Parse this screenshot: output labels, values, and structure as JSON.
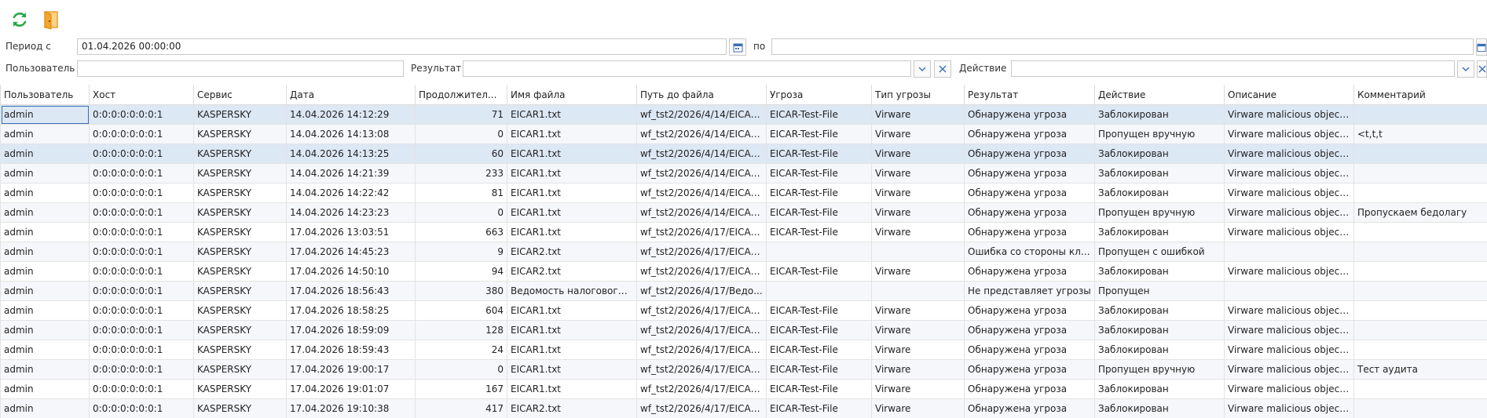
{
  "filters": {
    "period_from_label": "Период с",
    "period_from_value": "01.04.2026 00:00:00",
    "period_to_label": "по",
    "period_to_value": "",
    "user_label": "Пользователь",
    "user_value": "",
    "result_label": "Результат",
    "result_value": "",
    "action_label": "Действие",
    "action_value": ""
  },
  "icons": {
    "refresh": "refresh-icon",
    "exit": "exit-door-icon",
    "calendar": "calendar-icon",
    "chevron": "chevron-down-icon",
    "clear": "close-icon"
  },
  "colors": {
    "refresh": "#2aa84a",
    "exit": "#f2a62b",
    "selected_row": "#dde8f5",
    "accent": "#3b6fb6"
  },
  "table": {
    "columns": [
      "Пользователь",
      "Хост",
      "Сервис",
      "Дата",
      "Продолжител...",
      "Имя файла",
      "Путь до файла",
      "Угроза",
      "Тип угрозы",
      "Результат",
      "Действие",
      "Описание",
      "Комментарий"
    ],
    "rows": [
      [
        "admin",
        "0:0:0:0:0:0:0:1",
        "KASPERSKY",
        "14.04.2026 14:12:29",
        "71",
        "EICAR1.txt",
        "wf_tst2/2026/4/14/EICAR...",
        "EICAR-Test-File",
        "Virware",
        "Обнаружена угроза",
        "Заблокирован",
        "Virware malicious object ...",
        ""
      ],
      [
        "admin",
        "0:0:0:0:0:0:0:1",
        "KASPERSKY",
        "14.04.2026 14:13:08",
        "0",
        "EICAR1.txt",
        "wf_tst2/2026/4/14/EICAR...",
        "EICAR-Test-File",
        "Virware",
        "Обнаружена угроза",
        "Пропущен вручную",
        "Virware malicious object ...",
        "<t,t,t"
      ],
      [
        "admin",
        "0:0:0:0:0:0:0:1",
        "KASPERSKY",
        "14.04.2026 14:13:25",
        "60",
        "EICAR1.txt",
        "wf_tst2/2026/4/14/EICAR...",
        "EICAR-Test-File",
        "Virware",
        "Обнаружена угроза",
        "Заблокирован",
        "Virware malicious object ...",
        ""
      ],
      [
        "admin",
        "0:0:0:0:0:0:0:1",
        "KASPERSKY",
        "14.04.2026 14:21:39",
        "233",
        "EICAR1.txt",
        "wf_tst2/2026/4/14/EICAR...",
        "EICAR-Test-File",
        "Virware",
        "Обнаружена угроза",
        "Заблокирован",
        "Virware malicious object ...",
        ""
      ],
      [
        "admin",
        "0:0:0:0:0:0:0:1",
        "KASPERSKY",
        "14.04.2026 14:22:42",
        "81",
        "EICAR1.txt",
        "wf_tst2/2026/4/14/EICAR...",
        "EICAR-Test-File",
        "Virware",
        "Обнаружена угроза",
        "Заблокирован",
        "Virware malicious object ...",
        ""
      ],
      [
        "admin",
        "0:0:0:0:0:0:0:1",
        "KASPERSKY",
        "14.04.2026 14:23:23",
        "0",
        "EICAR1.txt",
        "wf_tst2/2026/4/14/EICAR...",
        "EICAR-Test-File",
        "Virware",
        "Обнаружена угроза",
        "Пропущен вручную",
        "Virware malicious object ...",
        "Пропускаем бедолагу"
      ],
      [
        "admin",
        "0:0:0:0:0:0:0:1",
        "KASPERSKY",
        "17.04.2026 13:03:51",
        "663",
        "EICAR1.txt",
        "wf_tst2/2026/4/17/EICAR...",
        "EICAR-Test-File",
        "Virware",
        "Обнаружена угроза",
        "Заблокирован",
        "Virware malicious object ...",
        ""
      ],
      [
        "admin",
        "0:0:0:0:0:0:0:1",
        "KASPERSKY",
        "17.04.2026 14:45:23",
        "9",
        "EICAR2.txt",
        "wf_tst2/2026/4/17/EICAR...",
        "",
        "",
        "Ошибка со стороны кли...",
        "Пропущен с ошибкой",
        "",
        ""
      ],
      [
        "admin",
        "0:0:0:0:0:0:0:1",
        "KASPERSKY",
        "17.04.2026 14:50:10",
        "94",
        "EICAR2.txt",
        "wf_tst2/2026/4/17/EICAR...",
        "EICAR-Test-File",
        "Virware",
        "Обнаружена угроза",
        "Заблокирован",
        "Virware malicious object ...",
        ""
      ],
      [
        "admin",
        "0:0:0:0:0:0:0:1",
        "KASPERSKY",
        "17.04.2026 18:56:43",
        "380",
        "Ведомость налогового ...",
        "wf_tst2/2026/4/17/Ведо...",
        "",
        "",
        "Не представляет угрозы",
        "Пропущен",
        "",
        ""
      ],
      [
        "admin",
        "0:0:0:0:0:0:0:1",
        "KASPERSKY",
        "17.04.2026 18:58:25",
        "604",
        "EICAR1.txt",
        "wf_tst2/2026/4/17/EICAR...",
        "EICAR-Test-File",
        "Virware",
        "Обнаружена угроза",
        "Заблокирован",
        "Virware malicious object ...",
        ""
      ],
      [
        "admin",
        "0:0:0:0:0:0:0:1",
        "KASPERSKY",
        "17.04.2026 18:59:09",
        "128",
        "EICAR1.txt",
        "wf_tst2/2026/4/17/EICAR...",
        "EICAR-Test-File",
        "Virware",
        "Обнаружена угроза",
        "Заблокирован",
        "Virware malicious object ...",
        ""
      ],
      [
        "admin",
        "0:0:0:0:0:0:0:1",
        "KASPERSKY",
        "17.04.2026 18:59:43",
        "24",
        "EICAR1.txt",
        "wf_tst2/2026/4/17/EICAR...",
        "EICAR-Test-File",
        "Virware",
        "Обнаружена угроза",
        "Заблокирован",
        "Virware malicious object ...",
        ""
      ],
      [
        "admin",
        "0:0:0:0:0:0:0:1",
        "KASPERSKY",
        "17.04.2026 19:00:17",
        "0",
        "EICAR1.txt",
        "wf_tst2/2026/4/17/EICAR...",
        "EICAR-Test-File",
        "Virware",
        "Обнаружена угроза",
        "Пропущен вручную",
        "Virware malicious object ...",
        "Тест аудита"
      ],
      [
        "admin",
        "0:0:0:0:0:0:0:1",
        "KASPERSKY",
        "17.04.2026 19:01:07",
        "167",
        "EICAR1.txt",
        "wf_tst2/2026/4/17/EICAR...",
        "EICAR-Test-File",
        "Virware",
        "Обнаружена угроза",
        "Заблокирован",
        "Virware malicious object ...",
        ""
      ],
      [
        "admin",
        "0:0:0:0:0:0:0:1",
        "KASPERSKY",
        "17.04.2026 19:10:38",
        "417",
        "EICAR2.txt",
        "wf_tst2/2026/4/17/EICAR...",
        "EICAR-Test-File",
        "Virware",
        "Обнаружена угроза",
        "Заблокирован",
        "Virware malicious object ...",
        ""
      ]
    ],
    "selected_rows": [
      0,
      2
    ]
  }
}
